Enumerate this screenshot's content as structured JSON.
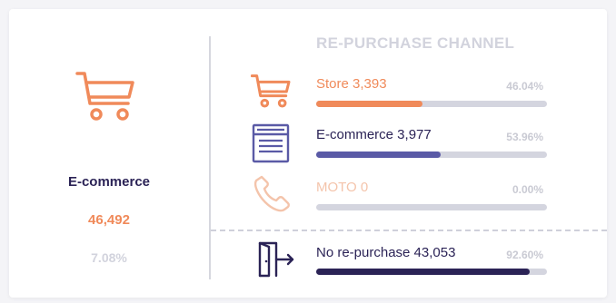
{
  "summary": {
    "title": "E-commerce",
    "value": "46,492",
    "percent": "7.08%",
    "icon": "shopping-cart-icon",
    "color": "#f08a5a"
  },
  "channel_title": "RE-PURCHASE CHANNEL",
  "channels": [
    {
      "label": "Store 3,393",
      "percent": "46.04%",
      "fraction": 0.4604,
      "icon": "shopping-cart-icon",
      "color": "#f08a5a",
      "label_color": "#f08a5a"
    },
    {
      "label": "E-commerce 3,977",
      "percent": "53.96%",
      "fraction": 0.5396,
      "icon": "browser-window-icon",
      "color": "#5a5aa6",
      "label_color": "#2b2356"
    },
    {
      "label": "MOTO 0",
      "percent": "0.00%",
      "fraction": 0.0,
      "icon": "phone-icon",
      "color": "#f4c4ab",
      "label_color": "#f4c4ab"
    }
  ],
  "no_repurchase": {
    "label": "No re-purchase 43,053",
    "percent": "92.60%",
    "fraction": 0.926,
    "icon": "exit-door-icon",
    "color": "#2b2356"
  }
}
